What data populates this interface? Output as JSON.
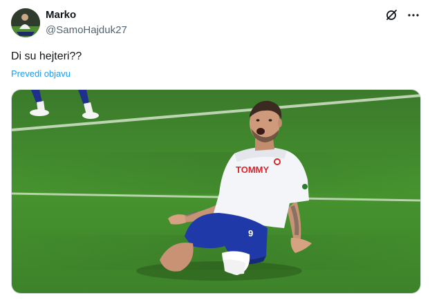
{
  "author": {
    "display_name": "Marko",
    "handle": "@SamoHajduk27",
    "avatar_icon": "user-avatar"
  },
  "header_actions": {
    "grok_icon": "grok-icon",
    "more_icon": "more-horizontal-icon"
  },
  "post": {
    "text": "Di su hejteri??",
    "translate_label": "Prevedi objavu"
  },
  "media": {
    "jersey_sponsor": "TOMMY",
    "shorts_number": "9"
  },
  "colors": {
    "link": "#1d9bf0",
    "secondary_text": "#536471",
    "pitch_green": "#3f8a2e"
  }
}
